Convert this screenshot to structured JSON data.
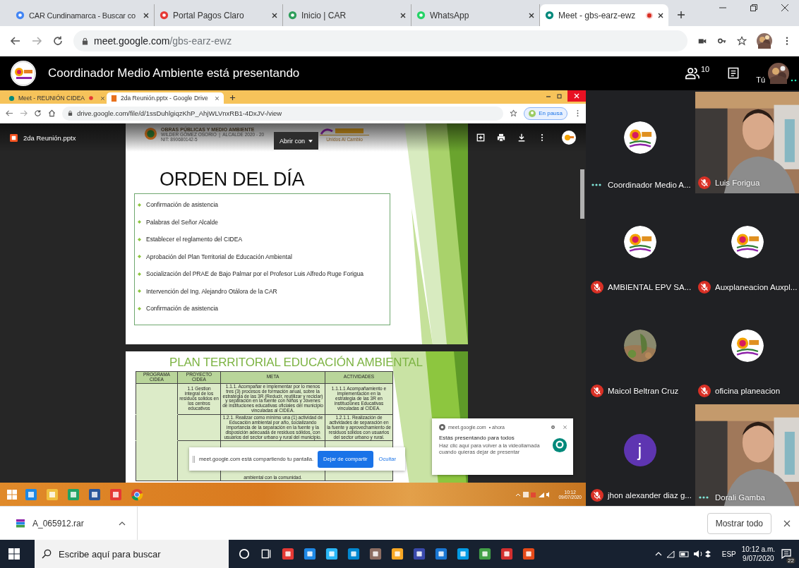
{
  "browser": {
    "tabs": [
      {
        "title": "CAR Cundinamarca - Buscar co",
        "selected": false,
        "recording": false
      },
      {
        "title": "Portal Pagos Claro",
        "selected": false,
        "recording": false
      },
      {
        "title": "Inicio | CAR",
        "selected": false,
        "recording": false
      },
      {
        "title": "WhatsApp",
        "selected": false,
        "recording": false
      },
      {
        "title": "Meet - gbs-earz-ewz",
        "selected": true,
        "recording": true
      }
    ],
    "url_host": "meet.google.com",
    "url_path": "/gbs-earz-ewz"
  },
  "meet_header": {
    "title": "Coordinador Medio Ambiente está presentando",
    "participant_count": "10",
    "self_label": "Tú"
  },
  "shared_screen": {
    "tabs": [
      {
        "title": "Meet - REUNIÓN CIDEA",
        "selected": false,
        "recording": true
      },
      {
        "title": "2da Reunión.pptx - Google Drive",
        "selected": true,
        "recording": false
      }
    ],
    "url": "drive.google.com/file/d/1ssDuhlgiqzKhP_AhjWLVnxRB1-4DxJV-/view",
    "profile_button": "En pausa",
    "file_name": "2da Reunión.pptx",
    "open_with": "Abrir con",
    "slide_1": {
      "org": "OBRAS PÚBLICAS Y MEDIO AMBIENTE",
      "mayor": "WILDER GÓMEZ OSORIO  |  ALCALDE 2020 - 20",
      "nit": "NIT: 890680142-5",
      "motto": "Unidos Al Cambio",
      "title": "ORDEN DEL DÍA",
      "items": [
        "Confirmación de asistencia",
        "Palabras del Señor Alcalde",
        "Establecer el reglamento del CIDEA",
        "Aprobación del  Plan Territorial de Educación Ambiental",
        "Socialización del PRAE de Bajo Palmar por el Profesor Luis Alfredo Ruge Forigua",
        "Intervención del Ing. Alejandro Otálora de la CAR",
        "Confirmación de asistencia"
      ]
    },
    "slide_2": {
      "title": "PLAN TERRITORIAL EDUCACIÓN  AMBIENTAL",
      "columns": [
        "PROGRAMA CIDEA",
        "PROYECTO CIDEA",
        "META",
        "ACTIVIDADES"
      ],
      "rows": [
        [
          "",
          "1.1 Gestion integral de los residuos solidos en los centros educativos",
          "1.1.1. Acompañar e implementar por lo menos tres (3) procesos de formación anual, sobre la estrategia de las 3R (Reducir, reutilizar y reciclar) y separación en la fuente con Niños y Jóvenes de instituciones educativas oficiales del municipio vinculadas al CIDEA.",
          "1.1.1.1 Acompañamiento e implementación en la estrategia de las 3R en instituciones Educativas vinculadas al CIDEA."
        ],
        [
          "",
          "",
          "1.2.1. Realizar como mínimo una (1) actividad de Educación ambiental por año, socializando importancia de la separación en la fuente y la disposición adecuada de residuos sólidos, con usuarios del sector urbano y rural del municipio.",
          "1.2.1.1. Realización de actividades de separación en la fuente y aprovechamiento de residuos sólidos con usuarios del sector urbano y rural."
        ],
        [
          "",
          "",
          "ambiental con la comunidad.",
          ""
        ]
      ]
    },
    "notification": {
      "source": "meet.google.com",
      "time": "• ahora",
      "title": "Estás presentando para todos",
      "body": "Haz clic aquí para volver a la videollamada cuando quieras dejar de presentar"
    },
    "share_bar": {
      "message": "meet.google.com está compartiendo tu pantalla.",
      "stop_button": "Dejar de compartir",
      "hide_link": "Ocultar"
    },
    "taskbar": {
      "time": "10:12",
      "date": "09/07/2020"
    }
  },
  "participants": [
    {
      "name": "Coordinador Medio A...",
      "muted": false,
      "kind": "logo"
    },
    {
      "name": "Luis Forigua",
      "muted": true,
      "kind": "video"
    },
    {
      "name": "AMBIENTAL EPV SA...",
      "muted": true,
      "kind": "logo"
    },
    {
      "name": "Auxplaneacion Auxpl...",
      "muted": true,
      "kind": "logo"
    },
    {
      "name": "Maicol Beltran Cruz",
      "muted": true
    },
    {
      "name": "oficina planeacion",
      "muted": true,
      "kind": "logo"
    },
    {
      "name": "jhon alexander diaz g...",
      "muted": true,
      "kind": "letter",
      "initial": "j"
    },
    {
      "name": "Dorali Gamba",
      "muted": false,
      "kind": "video"
    }
  ],
  "downloads": {
    "file": "A_065912.rar",
    "show_all": "Mostrar todo"
  },
  "taskbar": {
    "search_placeholder": "Escribe aquí para buscar",
    "language": "ESP",
    "time": "10:12 a.m.",
    "date": "9/07/2020",
    "notifications": "22"
  }
}
